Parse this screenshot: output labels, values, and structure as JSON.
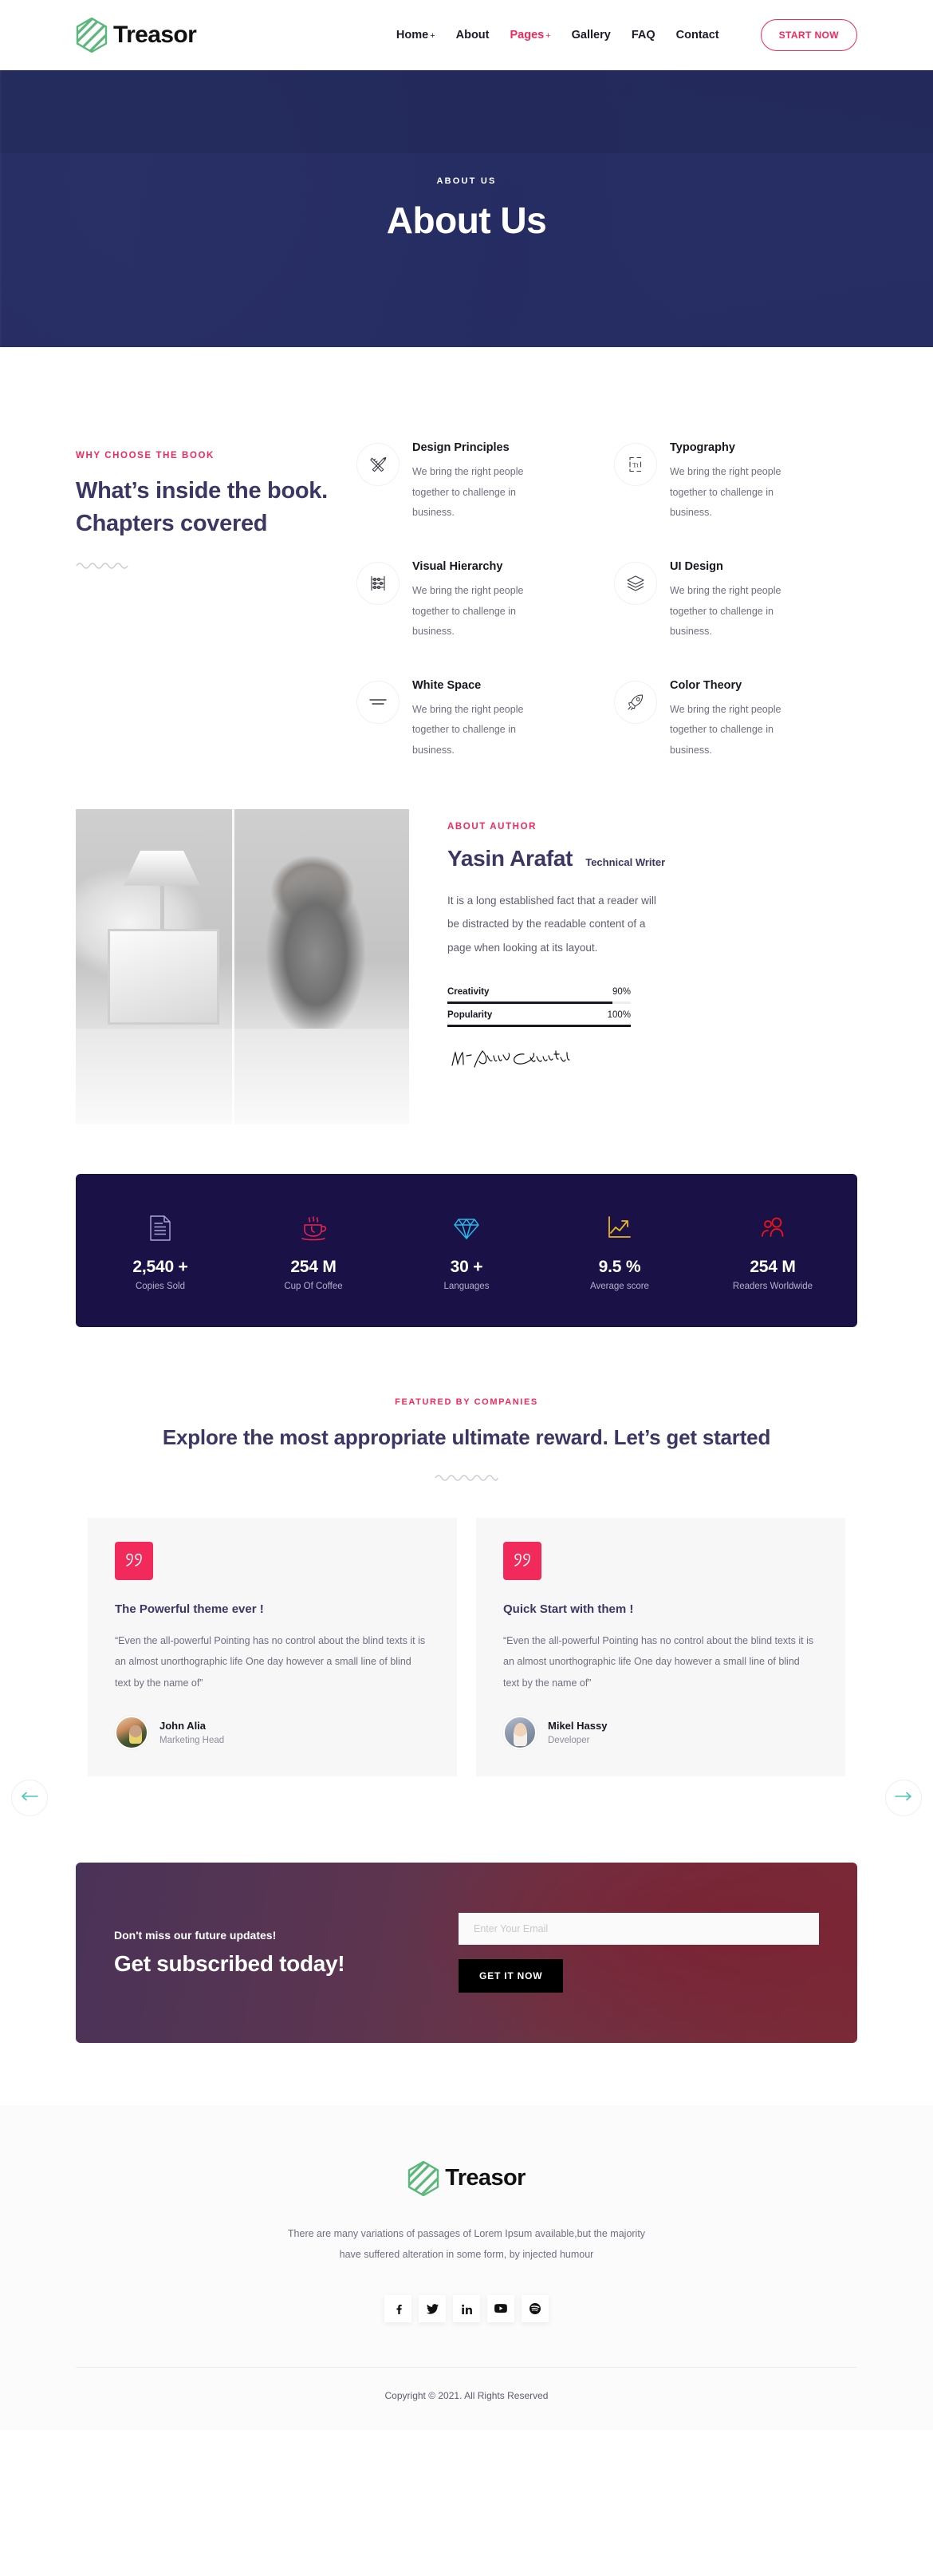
{
  "brand": {
    "name": "Treasor",
    "logo_icon": "hexagon-stripes-icon"
  },
  "nav": {
    "items": [
      {
        "label": "Home",
        "caret": "+",
        "active": false
      },
      {
        "label": "About",
        "caret": "",
        "active": false
      },
      {
        "label": "Pages",
        "caret": "+",
        "active": true
      },
      {
        "label": "Gallery",
        "caret": "",
        "active": false
      },
      {
        "label": "FAQ",
        "caret": "",
        "active": false
      },
      {
        "label": "Contact",
        "caret": "",
        "active": false
      }
    ],
    "cta_label": "START NOW"
  },
  "hero": {
    "eyebrow": "ABOUT US",
    "title": "About Us",
    "bg_color": "#262d63"
  },
  "features": {
    "eyebrow": "WHY CHOOSE THE BOOK",
    "heading": "What’s inside the book. Chapters covered",
    "items": [
      {
        "icon": "ruler-pencil-icon",
        "title": "Design Principles",
        "desc": "We bring the right people together to challenge in business."
      },
      {
        "icon": "typography-icon",
        "title": "Typography",
        "desc": "We bring the right people together to challenge in business."
      },
      {
        "icon": "abacus-icon",
        "title": "Visual Hierarchy",
        "desc": "We bring the right people together to challenge in business."
      },
      {
        "icon": "layers-icon",
        "title": "UI Design",
        "desc": "We bring the right people together to challenge in business."
      },
      {
        "icon": "lines-icon",
        "title": "White Space",
        "desc": "We bring the right people together to challenge in business."
      },
      {
        "icon": "rocket-icon",
        "title": "Color Theory",
        "desc": "We bring the right people together to challenge in business."
      }
    ]
  },
  "author": {
    "eyebrow": "ABOUT AUTHOR",
    "name": "Yasin Arafat",
    "role": "Technical Writer",
    "bio": "It is a long established fact that a reader will be distracted by the readable content of a page when looking at its layout.",
    "skills": [
      {
        "name": "Creativity",
        "value": "90%",
        "percent": 90
      },
      {
        "name": "Popularity",
        "value": "100%",
        "percent": 100
      }
    ],
    "signature_text": "Md Yasin Arafat",
    "photo_alt": "author-working-at-desk"
  },
  "stats": {
    "bg_color": "#1a1246",
    "items": [
      {
        "icon": "document-icon",
        "color": "#a9a7d6",
        "number": "2,540 +",
        "label": "Copies Sold"
      },
      {
        "icon": "coffee-cup-icon",
        "color": "#e8264f",
        "number": "254 M",
        "label": "Cup Of Coffee"
      },
      {
        "icon": "diamond-icon",
        "color": "#29b6e8",
        "number": "30 +",
        "label": "Languages"
      },
      {
        "icon": "growth-chart-icon",
        "color": "#e8b426",
        "number": "9.5 %",
        "label": "Average score"
      },
      {
        "icon": "people-icon",
        "color": "#f21414",
        "number": "254 M",
        "label": "Readers Worldwide"
      }
    ]
  },
  "testimonials": {
    "eyebrow": "FEATURED BY COMPANIES",
    "heading": "Explore the most appropriate ultimate reward. Let’s get started",
    "prev_icon": "arrow-left-icon",
    "next_icon": "arrow-right-icon",
    "cards": [
      {
        "badge_icon": "quote-icon",
        "title": "The Powerful theme ever !",
        "text": "“Even the all-powerful Pointing has no control about the blind texts it is an almost unorthographic life One day however a small line of blind text by the name of”",
        "person_name": "John Alia",
        "person_role": "Marketing Head"
      },
      {
        "badge_icon": "quote-icon",
        "title": "Quick Start with them !",
        "text": "“Even the all-powerful Pointing has no control about the blind texts it is an almost unorthographic life One day however a small line of blind text by the name of”",
        "person_name": "Mikel Hassy",
        "person_role": "Developer"
      }
    ]
  },
  "subscribe": {
    "small_title": "Don't miss our future updates!",
    "big_title": "Get subscribed today!",
    "email_placeholder": "Enter Your Email",
    "email_value": "",
    "button_label": "GET IT NOW"
  },
  "footer": {
    "brand_name": "Treasor",
    "text": "There are many variations of passages of Lorem Ipsum available,but the majority have suffered alteration in some form, by injected humour",
    "socials": [
      {
        "icon": "facebook-icon"
      },
      {
        "icon": "twitter-icon"
      },
      {
        "icon": "linkedin-icon"
      },
      {
        "icon": "youtube-icon"
      },
      {
        "icon": "spotify-icon"
      }
    ],
    "copyright": "Copyright © 2021. All Rights Reserved"
  },
  "colors": {
    "accent_pink": "#f2295b",
    "heading_navy": "#3b3663",
    "hero_navy": "#262d63",
    "stats_navy": "#1a1246",
    "logo_green": "#5cb87a"
  }
}
